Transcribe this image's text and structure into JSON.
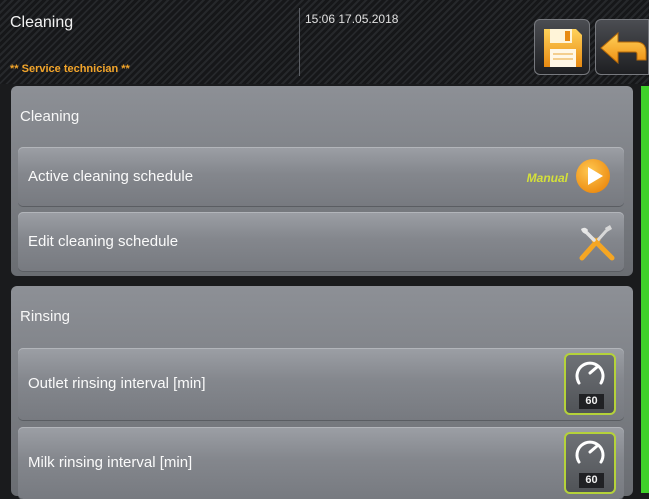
{
  "header": {
    "title": "Cleaning",
    "subtitle": "** Service technician **",
    "datetime": "15:06 17.05.2018",
    "save_icon": "floppy-disk-icon",
    "back_icon": "back-arrow-icon"
  },
  "sections": [
    {
      "title": "Cleaning",
      "rows": [
        {
          "label": "Active cleaning schedule",
          "value": "Manual",
          "icon": "play-icon"
        },
        {
          "label": "Edit cleaning schedule",
          "icon": "tools-icon"
        }
      ]
    },
    {
      "title": "Rinsing",
      "rows": [
        {
          "label": "Outlet rinsing interval [min]",
          "value": "60",
          "icon": "gauge-icon"
        },
        {
          "label": "Milk rinsing interval [min]",
          "value": "60",
          "icon": "gauge-icon"
        }
      ]
    }
  ],
  "colors": {
    "accent_orange": "#f3a52a",
    "status_green": "#3fd12a",
    "manual_yellow": "#d4e03a"
  }
}
